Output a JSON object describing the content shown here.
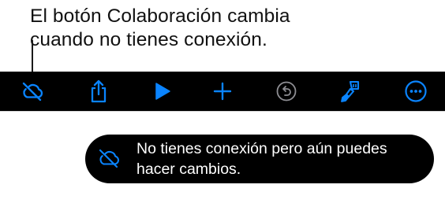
{
  "callout": {
    "line1": "El botón Colaboración cambia",
    "line2": "cuando no tienes conexión."
  },
  "toolbar": {
    "buttons": [
      {
        "name": "collaboration-offline",
        "icon": "cloud-slash-icon"
      },
      {
        "name": "share",
        "icon": "share-icon"
      },
      {
        "name": "play",
        "icon": "play-icon"
      },
      {
        "name": "add",
        "icon": "plus-icon"
      },
      {
        "name": "undo",
        "icon": "undo-icon",
        "enabled": false
      },
      {
        "name": "format",
        "icon": "paintbrush-icon"
      },
      {
        "name": "more",
        "icon": "ellipsis-circle-icon"
      }
    ],
    "colors": {
      "background": "#000000",
      "accent": "#0a84ff",
      "disabled": "#8e8e93"
    }
  },
  "toast": {
    "icon": "cloud-slash-icon",
    "line1": "No tienes conexión pero aún puedes",
    "line2": "hacer cambios."
  }
}
